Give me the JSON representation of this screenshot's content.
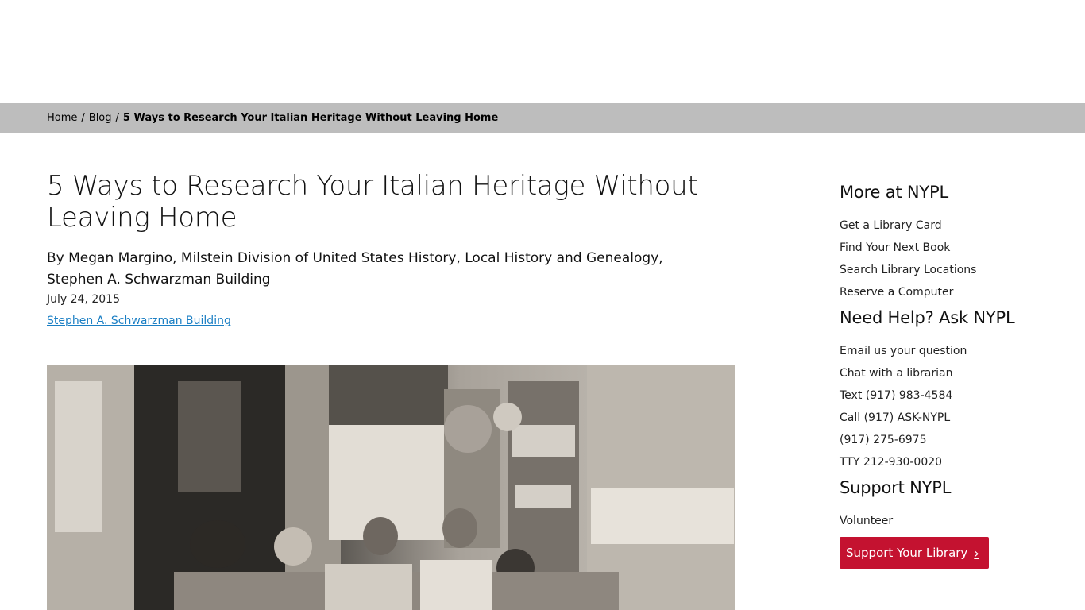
{
  "breadcrumb": {
    "home": "Home",
    "blog": "Blog",
    "current": "5 Ways to Research Your Italian Heritage Without Leaving Home",
    "separator": "/"
  },
  "article": {
    "title": "5 Ways to Research Your Italian Heritage Without Leaving Home",
    "byline": "By Megan Margino, Milstein Division of United States History, Local History and Genealogy, Stephen A. Schwarzman Building",
    "date": "July 24, 2015",
    "location_link": "Stephen A. Schwarzman Building"
  },
  "sidebar": {
    "more_heading": "More at NYPL",
    "more_links": [
      "Get a Library Card",
      "Find Your Next Book",
      "Search Library Locations",
      "Reserve a Computer"
    ],
    "help_heading": "Need Help? Ask NYPL",
    "help_links": [
      "Email us your question",
      "Chat with a librarian",
      "Text (917) 983-4584",
      "Call (917) ASK-NYPL",
      "(917) 275-6975",
      "TTY 212-930-0020"
    ],
    "support_heading": "Support NYPL",
    "support_links": [
      "Volunteer"
    ],
    "support_button": "Support Your Library",
    "button_color": "#c41230"
  }
}
